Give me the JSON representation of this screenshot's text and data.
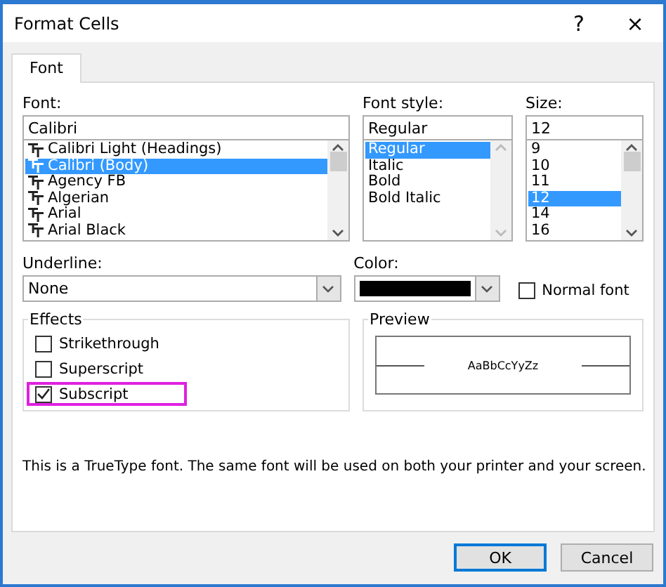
{
  "window": {
    "title": "Format Cells",
    "help": "?",
    "close": "×"
  },
  "tabs": [
    {
      "label": "Font",
      "selected": true
    }
  ],
  "font": {
    "label": "Font:",
    "value": "Calibri",
    "items": [
      {
        "label": "Calibri Light (Headings)",
        "selected": false
      },
      {
        "label": "Calibri (Body)",
        "selected": true
      },
      {
        "label": "Agency FB",
        "selected": false
      },
      {
        "label": "Algerian",
        "selected": false
      },
      {
        "label": "Arial",
        "selected": false
      },
      {
        "label": "Arial Black",
        "selected": false
      }
    ]
  },
  "font_style": {
    "label": "Font style:",
    "value": "Regular",
    "items": [
      {
        "label": "Regular",
        "selected": true
      },
      {
        "label": "Italic",
        "selected": false
      },
      {
        "label": "Bold",
        "selected": false
      },
      {
        "label": "Bold Italic",
        "selected": false
      }
    ]
  },
  "size": {
    "label": "Size:",
    "value": "12",
    "items": [
      {
        "label": "9",
        "selected": false
      },
      {
        "label": "10",
        "selected": false
      },
      {
        "label": "11",
        "selected": false
      },
      {
        "label": "12",
        "selected": true
      },
      {
        "label": "14",
        "selected": false
      },
      {
        "label": "16",
        "selected": false
      }
    ]
  },
  "underline": {
    "label": "Underline:",
    "value": "None"
  },
  "color": {
    "label": "Color:",
    "color": "#000000"
  },
  "normal_font": {
    "label": "Normal font",
    "checked": false
  },
  "effects": {
    "title": "Effects",
    "items": [
      {
        "label": "Strikethrough",
        "checked": false,
        "highlighted": false
      },
      {
        "label": "Superscript",
        "checked": false,
        "highlighted": false
      },
      {
        "label": "Subscript",
        "checked": true,
        "highlighted": true
      }
    ]
  },
  "preview": {
    "title": "Preview",
    "sample": "AaBbCcYyZz"
  },
  "info": "This is a TrueType font.  The same font will be used on both your printer and your screen.",
  "buttons": [
    {
      "label": "OK",
      "default": true
    },
    {
      "label": "Cancel",
      "default": false
    }
  ]
}
